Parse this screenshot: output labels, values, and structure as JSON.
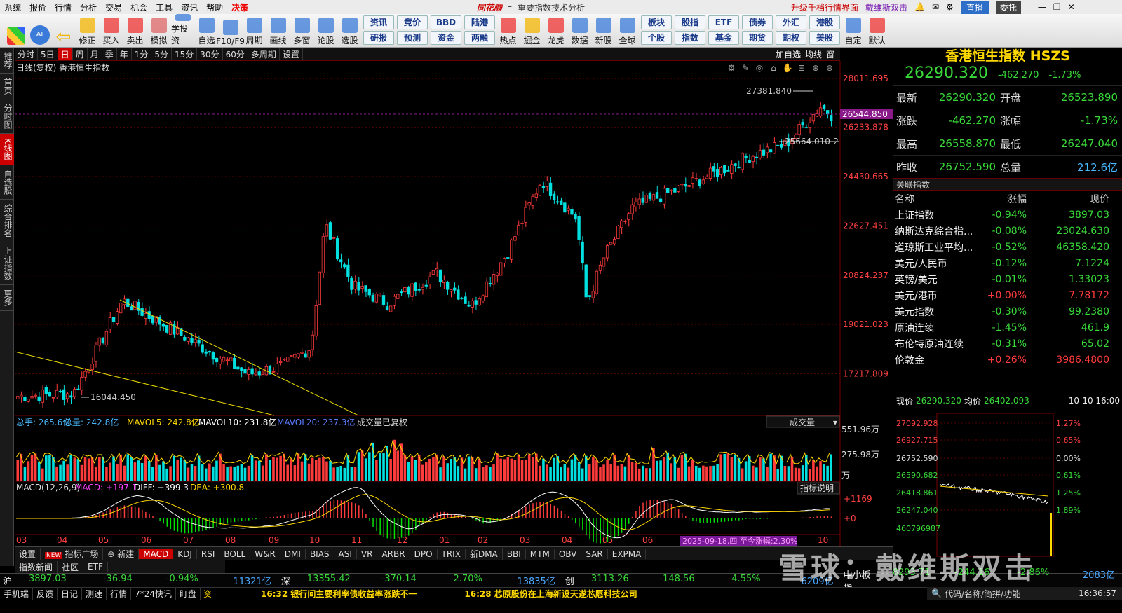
{
  "menu": [
    "系统",
    "报价",
    "行情",
    "分析",
    "交易",
    "机会",
    "工具",
    "资讯",
    "帮助",
    "决策"
  ],
  "app": {
    "logo": "同花顺",
    "separator": "–",
    "title": "重要指数技术分析"
  },
  "menu_right": {
    "upgrade": "升级千档行情界面",
    "user": "戴维斯双击",
    "live": "直播",
    "trust": "委托"
  },
  "toolbar": [
    "修正",
    "买入",
    "卖出",
    "模拟",
    "学投资",
    "自选",
    "F10/F9",
    "周期",
    "画线",
    "多窗",
    "论股",
    "选股"
  ],
  "toolbar_grid": [
    [
      "资讯",
      "研报"
    ],
    [
      "竞价",
      "预测"
    ],
    [
      "BBD",
      "资金"
    ],
    [
      "陆港",
      "两融"
    ]
  ],
  "toolbar2": [
    "热点",
    "掘金",
    "龙虎",
    "数据",
    "新股",
    "全球"
  ],
  "toolbar_grid2": [
    [
      "板块",
      "个股"
    ],
    [
      "股指",
      "指数"
    ],
    [
      "ETF",
      "基金"
    ],
    [
      "债券",
      "期货"
    ],
    [
      "外汇",
      "期权"
    ],
    [
      "港股",
      "美股"
    ]
  ],
  "toolbar3": [
    "自定",
    "默认"
  ],
  "leftnav": [
    "推荐",
    "首页",
    "分时图",
    "K线图",
    "自选股",
    "综合排名",
    "上证指数",
    "更多"
  ],
  "periods": [
    "分时",
    "5日",
    "日",
    "周",
    "月",
    "季",
    "年",
    "1分",
    "5分",
    "15分",
    "30分",
    "60分",
    "多周期",
    "设置"
  ],
  "period_right": [
    "加自选",
    "均线",
    "窗"
  ],
  "chart": {
    "label": "日线(复权) 香港恒生指数",
    "yticks": [
      "28011.695",
      "26233.878",
      "24430.665",
      "22627.451",
      "20824.237",
      "19021.023",
      "17217.809"
    ],
    "current_price_tag": "26544.850",
    "high_label": "27381.840",
    "low_label": "16044.450",
    "range_label": "25664.010-2",
    "xticks": [
      "03",
      "04",
      "05",
      "06",
      "07",
      "08",
      "09",
      "10",
      "11",
      "12",
      "01",
      "02",
      "03",
      "04",
      "05",
      "06",
      "10"
    ],
    "date_highlight": "2025-09-18,四 至今涨幅:2.30%"
  },
  "volume": {
    "label_total": "总手: 265.6亿",
    "label_vol": "总量: 242.8亿",
    "label_ma5": "MAVOL5: 242.8亿",
    "label_ma10": "MAVOL10: 231.8亿",
    "label_ma20": "MAVOL20: 237.3亿",
    "label_note": "成交量已复权",
    "selector": "成交量",
    "yticks": [
      "551.96万",
      "275.98万",
      "万"
    ]
  },
  "macd": {
    "label": "MACD(12,26,9)",
    "label_macd": "MACD: +197.1",
    "label_diff": "DIFF: +399.3",
    "label_dea": "DEA: +300.8",
    "help": "指标说明",
    "yticks": [
      "+1169",
      "+0"
    ]
  },
  "indicators": [
    "设置",
    "指标广场",
    "新建",
    "MACD",
    "KDJ",
    "RSI",
    "BOLL",
    "W&R",
    "DMI",
    "BIAS",
    "ASI",
    "VR",
    "ARBR",
    "DPO",
    "TRIX",
    "新DMA",
    "BBI",
    "MTM",
    "OBV",
    "SAR",
    "EXPMA"
  ],
  "new_badge": "NEW",
  "bottom_tabs": [
    "指数新闻",
    "社区",
    "ETF"
  ],
  "quote": {
    "title": "香港恒生指数 HSZS",
    "price": "26290.320",
    "change": "-462.270",
    "pct": "-1.73%",
    "rows": [
      {
        "k": "最新",
        "v": "26290.320",
        "k2": "开盘",
        "v2": "26523.890"
      },
      {
        "k": "涨跌",
        "v": "-462.270",
        "k2": "涨幅",
        "v2": "-1.73%"
      },
      {
        "k": "最高",
        "v": "26558.870",
        "k2": "最低",
        "v2": "26247.040"
      },
      {
        "k": "昨收",
        "v": "26752.590",
        "k2": "总量",
        "v2": "212.6亿"
      }
    ]
  },
  "related": {
    "header": "关联指数",
    "cols": [
      "名称",
      "涨幅",
      "现价"
    ],
    "rows": [
      {
        "n": "上证指数",
        "c": "-0.94%",
        "p": "3897.03",
        "up": false
      },
      {
        "n": "纳斯达克综合指...",
        "c": "-0.08%",
        "p": "23024.630",
        "up": false
      },
      {
        "n": "道琼斯工业平均...",
        "c": "-0.52%",
        "p": "46358.420",
        "up": false
      },
      {
        "n": "美元/人民币",
        "c": "-0.12%",
        "p": "7.1224",
        "up": false
      },
      {
        "n": "英镑/美元",
        "c": "-0.01%",
        "p": "1.33023",
        "up": false
      },
      {
        "n": "美元/港币",
        "c": "+0.00%",
        "p": "7.78172",
        "up": true
      },
      {
        "n": "美元指数",
        "c": "-0.30%",
        "p": "99.2380",
        "up": false
      },
      {
        "n": "原油连续",
        "c": "-1.45%",
        "p": "461.9",
        "up": false
      },
      {
        "n": "布伦特原油连续",
        "c": "-0.31%",
        "p": "65.02",
        "up": false
      },
      {
        "n": "伦敦金",
        "c": "+0.26%",
        "p": "3986.4800",
        "up": true
      }
    ]
  },
  "mini": {
    "price_label": "现价",
    "price": "26290.320",
    "avg_label": "均价",
    "avg": "26402.093",
    "date": "10-10 16:00",
    "left_ticks": [
      "27092.928",
      "26927.715",
      "26752.590",
      "26590.682",
      "26418.861",
      "26247.040",
      "460796987"
    ],
    "right_ticks": [
      "1.27%",
      "0.65%",
      "0.00%",
      "0.61%",
      "1.25%",
      "1.89%"
    ]
  },
  "status": [
    {
      "k": "沪",
      "v": "3897.03",
      "c": "-36.94",
      "p": "-0.94%",
      "a": "11321亿"
    },
    {
      "k": "深",
      "v": "13355.42",
      "c": "-370.14",
      "p": "-2.70%",
      "a": "13835亿"
    },
    {
      "k": "创",
      "v": "3113.26",
      "c": "-148.56",
      "p": "-4.55%",
      "a": "6209亿"
    },
    {
      "k": "中小板指",
      "v": "8293.71",
      "c": "-244.16",
      "p": "-2.86%",
      "a": "2083亿"
    }
  ],
  "ticker_tabs": [
    "手机端",
    "反馈",
    "日记",
    "测速",
    "行情",
    "7*24快讯",
    "盯盘"
  ],
  "ticker_icon": "资",
  "news1": "16:32 银行间主要利率债收益率涨跌不一",
  "news2": "16:28 芯原股份在上海新设天遂芯愿科技公司",
  "bottom_right": "代码/名称/简拼/功能",
  "clock": "16:36:57",
  "watermark": "雪球：戴维斯双击"
}
